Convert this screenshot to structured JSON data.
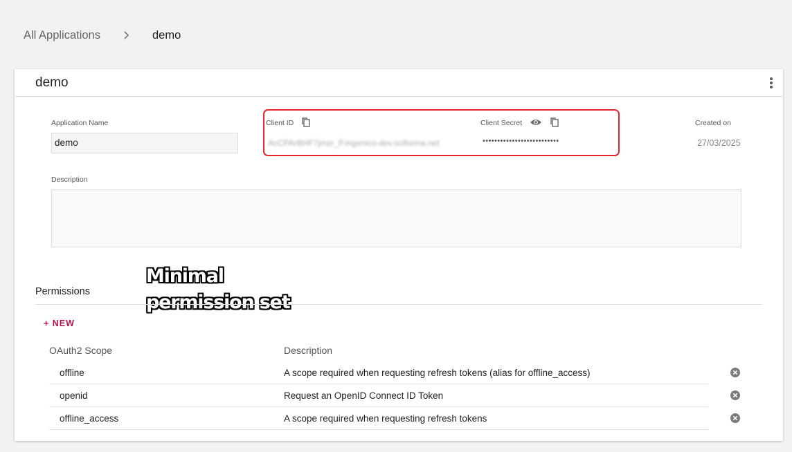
{
  "breadcrumb": {
    "root": "All Applications",
    "current": "demo"
  },
  "card": {
    "title": "demo"
  },
  "fields": {
    "app_name_label": "Application Name",
    "app_name_value": "demo",
    "client_id_label": "Client ID",
    "client_id_value": "AcCPArBHF7jmzr_P.ingenico-dev.sciforma.net",
    "client_secret_label": "Client Secret",
    "client_secret_value": "••••••••••••••••••••••••••",
    "created_label": "Created on",
    "created_value": "27/03/2025",
    "description_label": "Description",
    "description_value": ""
  },
  "annotation": {
    "line1": "Minimal",
    "line2": "permission set"
  },
  "permissions": {
    "title": "Permissions",
    "new_label": "+ NEW",
    "columns": [
      "OAuth2 Scope",
      "Description"
    ],
    "rows": [
      {
        "scope": "offline",
        "description": "A scope required when requesting refresh tokens (alias for offline_access)"
      },
      {
        "scope": "openid",
        "description": "Request an OpenID Connect ID Token"
      },
      {
        "scope": "offline_access",
        "description": "A scope required when requesting refresh tokens"
      }
    ]
  },
  "colors": {
    "accent": "#b3124a",
    "highlight": "#e8232e",
    "background": "#f2f2f2"
  }
}
